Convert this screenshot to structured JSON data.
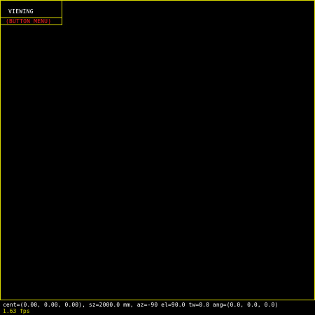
{
  "menu": {
    "title": "VIEWING",
    "button_label": "(BUTTON MENU)"
  },
  "status": {
    "view_params": "cent=(0.00, 0.00, 0.00), sz=2000.0 mm, az=-90 el=90.0 tw=0.0 ang=(0.0, 0.0, 0.0)",
    "fps": "1.63 fps"
  },
  "colors": {
    "background": "#000000",
    "border": "#d8d800",
    "title_text": "#ffffff",
    "button_text": "#ff2020",
    "fps_text": "#d8d800"
  }
}
